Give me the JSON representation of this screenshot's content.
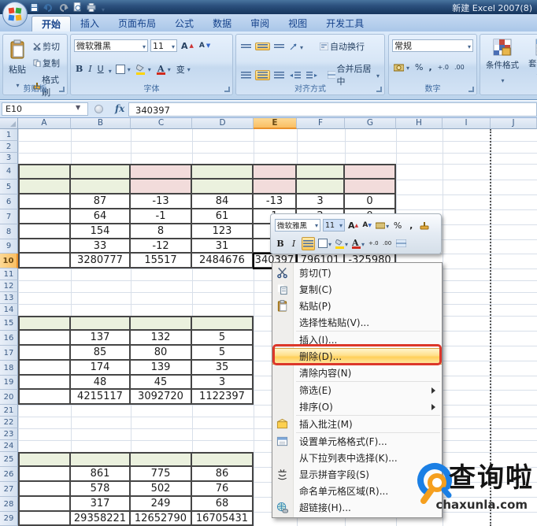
{
  "window": {
    "title": "新建 Excel 2007(8)"
  },
  "quick_access": {
    "icons": [
      "save-icon",
      "undo-icon",
      "redo-icon",
      "print-preview-icon",
      "dropdown-caret-icon"
    ]
  },
  "tabs": [
    {
      "label": "开始",
      "active": true
    },
    {
      "label": "插入",
      "active": false
    },
    {
      "label": "页面布局",
      "active": false
    },
    {
      "label": "公式",
      "active": false
    },
    {
      "label": "数据",
      "active": false
    },
    {
      "label": "审阅",
      "active": false
    },
    {
      "label": "视图",
      "active": false
    },
    {
      "label": "开发工具",
      "active": false
    }
  ],
  "ribbon": {
    "clipboard": {
      "label": "剪贴板",
      "paste": "粘贴",
      "cut": "剪切",
      "copy": "复制",
      "format_painter": "格式刷"
    },
    "font": {
      "label": "字体",
      "font_name": "微软雅黑",
      "font_size": "11",
      "bold": "B",
      "italic": "I",
      "underline": "U",
      "phonetic": "变",
      "grow_letter": "A",
      "shrink_letter": "A"
    },
    "alignment": {
      "label": "对齐方式",
      "wrap_text": "自动换行",
      "merge_center": "合并后居中"
    },
    "number": {
      "label": "数字",
      "format": "常规",
      "percent": "%",
      "comma": ","
    },
    "styles": {
      "conditional": "条件格式",
      "format_table": "套用表格格式"
    }
  },
  "formula_bar": {
    "name_box": "E10",
    "fx": "fx",
    "value": "340397"
  },
  "grid": {
    "columns": [
      "A",
      "B",
      "C",
      "D",
      "E",
      "F",
      "G",
      "H",
      "I",
      "J"
    ],
    "row_count": 29,
    "selected_cell": "E10",
    "selected_column": "E",
    "selected_row": 10,
    "colors": {
      "green": "#ebf1de",
      "pink": "#f2dcdb"
    },
    "page_break_after_column": "I",
    "tables": [
      {
        "cols": [
          "A",
          "B",
          "C",
          "D",
          "E",
          "F",
          "G"
        ],
        "header_rows": [
          4,
          5
        ],
        "header_fills": [
          "green",
          "green",
          "pink",
          "green",
          "pink",
          "green",
          "pink"
        ],
        "first_data_row": 6,
        "rows": [
          [
            "",
            "87",
            "-13",
            "84",
            "-13",
            "3",
            "0"
          ],
          [
            "",
            "64",
            "-1",
            "61",
            "1",
            "2",
            "0"
          ],
          [
            "",
            "154",
            "8",
            "123",
            "",
            "",
            ""
          ],
          [
            "",
            "33",
            "-12",
            "31",
            "",
            "",
            ""
          ],
          [
            "",
            "3280777",
            "15517",
            "2484676",
            "340397",
            "796101",
            "-325980"
          ]
        ]
      },
      {
        "cols": [
          "A",
          "B",
          "C",
          "D"
        ],
        "header_rows": [
          15
        ],
        "header_fills": [
          "green",
          "green",
          "green",
          "green"
        ],
        "first_data_row": 16,
        "rows": [
          [
            "",
            "137",
            "132",
            "5"
          ],
          [
            "",
            "85",
            "80",
            "5"
          ],
          [
            "",
            "174",
            "139",
            "35"
          ],
          [
            "",
            "48",
            "45",
            "3"
          ],
          [
            "",
            "4215117",
            "3092720",
            "1122397"
          ]
        ]
      },
      {
        "cols": [
          "A",
          "B",
          "C",
          "D"
        ],
        "header_rows": [
          25
        ],
        "header_fills": [
          "green",
          "green",
          "green",
          "green"
        ],
        "first_data_row": 26,
        "rows": [
          [
            "",
            "861",
            "775",
            "86"
          ],
          [
            "",
            "578",
            "502",
            "76"
          ],
          [
            "",
            "317",
            "249",
            "68"
          ],
          [
            "",
            "29358221",
            "12652790",
            "16705431"
          ]
        ]
      }
    ]
  },
  "mini_toolbar": {
    "font_name": "微软雅黑",
    "font_size": "11"
  },
  "context_menu": {
    "items": [
      {
        "label": "剪切(T)",
        "icon": "scissors-icon"
      },
      {
        "label": "复制(C)",
        "icon": "copy-icon"
      },
      {
        "label": "粘贴(P)",
        "icon": "paste-icon"
      },
      {
        "label": "选择性粘贴(V)...",
        "sep_after": true
      },
      {
        "label": "插入(I)..."
      },
      {
        "label": "删除(D)...",
        "highlighted": true,
        "annotated": true
      },
      {
        "label": "清除内容(N)",
        "sep_after": true
      },
      {
        "label": "筛选(E)",
        "submenu": true
      },
      {
        "label": "排序(O)",
        "submenu": true,
        "sep_after": true
      },
      {
        "label": "插入批注(M)",
        "icon": "comment-icon",
        "sep_after": true
      },
      {
        "label": "设置单元格格式(F)...",
        "icon": "format-cells-icon"
      },
      {
        "label": "从下拉列表中选择(K)..."
      },
      {
        "label": "显示拼音字段(S)",
        "icon": "phonetic-icon"
      },
      {
        "label": "命名单元格区域(R)..."
      },
      {
        "label": "超链接(H)...",
        "icon": "hyperlink-icon"
      }
    ]
  },
  "watermark": {
    "name": "查询啦",
    "domain": "chaxunla.com"
  }
}
